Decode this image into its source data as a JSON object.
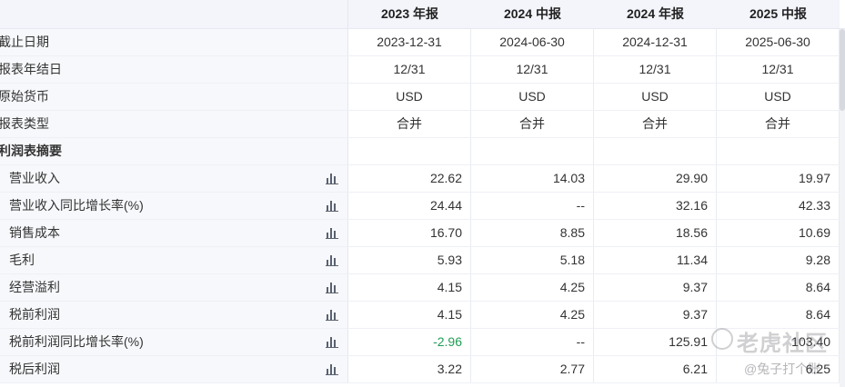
{
  "header": {
    "columns": [
      "2023 年报",
      "2024 中报",
      "2024 年报",
      "2025 中报"
    ]
  },
  "meta_rows": [
    {
      "label": "截止日期",
      "values": [
        "2023-12-31",
        "2024-06-30",
        "2024-12-31",
        "2025-06-30"
      ]
    },
    {
      "label": "报表年结日",
      "values": [
        "12/31",
        "12/31",
        "12/31",
        "12/31"
      ]
    },
    {
      "label": "原始货币",
      "values": [
        "USD",
        "USD",
        "USD",
        "USD"
      ]
    },
    {
      "label": "报表类型",
      "values": [
        "合并",
        "合并",
        "合并",
        "合并"
      ]
    }
  ],
  "section_title": "利润表摘要",
  "data_rows": [
    {
      "label": "营业收入",
      "values": [
        "22.62",
        "14.03",
        "29.90",
        "19.97"
      ]
    },
    {
      "label": "营业收入同比增长率(%)",
      "values": [
        "24.44",
        "--",
        "32.16",
        "42.33"
      ]
    },
    {
      "label": "销售成本",
      "values": [
        "16.70",
        "8.85",
        "18.56",
        "10.69"
      ]
    },
    {
      "label": "毛利",
      "values": [
        "5.93",
        "5.18",
        "11.34",
        "9.28"
      ]
    },
    {
      "label": "经营溢利",
      "values": [
        "4.15",
        "4.25",
        "9.37",
        "8.64"
      ]
    },
    {
      "label": "税前利润",
      "values": [
        "4.15",
        "4.25",
        "9.37",
        "8.64"
      ]
    },
    {
      "label": "税前利润同比增长率(%)",
      "values": [
        "-2.96",
        "--",
        "125.91",
        "103.40"
      ]
    },
    {
      "label": "税后利润",
      "values": [
        "3.22",
        "2.77",
        "6.21",
        "6.25"
      ]
    }
  ],
  "colors": {
    "negative": "#1f9d55",
    "icon": "#5a6270"
  },
  "watermark": {
    "brand": "老虎社区",
    "author": "@兔子打个账"
  }
}
